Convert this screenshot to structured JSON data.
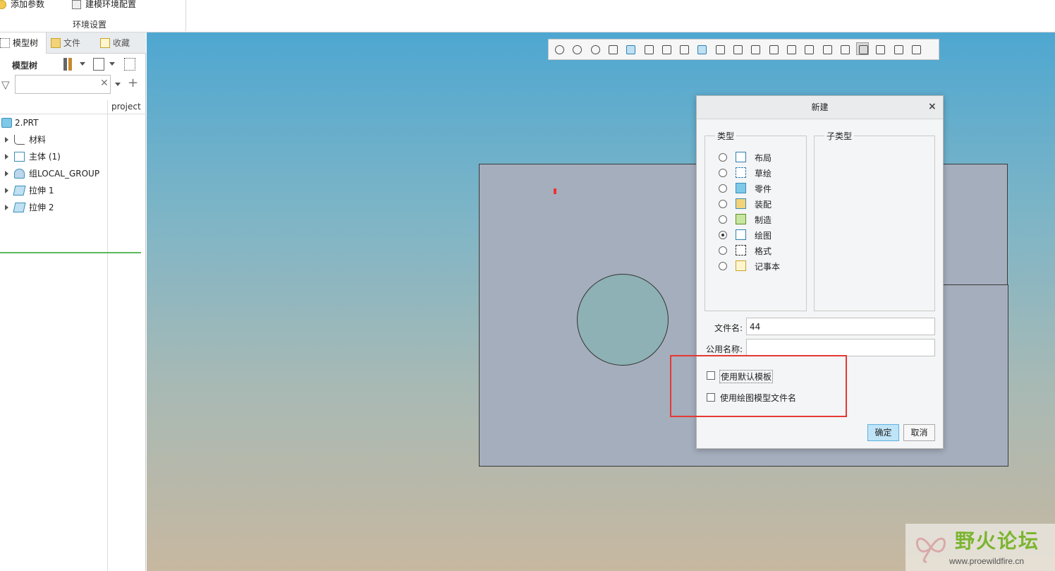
{
  "ribbon": {
    "add_params": "添加参数",
    "model_env_config": "建模环境配置",
    "group_label": "环境设置"
  },
  "left_panel": {
    "tabs": [
      {
        "label": "模型树"
      },
      {
        "label": "文件"
      },
      {
        "label": "收藏"
      }
    ],
    "tree_title": "模型树",
    "search": {
      "value": "",
      "placeholder": ""
    },
    "columns": {
      "project": "project"
    },
    "tree": [
      {
        "label": "2.PRT",
        "icon": "part-icon"
      },
      {
        "label": "材料",
        "icon": "material-icon"
      },
      {
        "label": "主体 (1)",
        "icon": "body-icon"
      },
      {
        "label": "组LOCAL_GROUP",
        "icon": "group-icon"
      },
      {
        "label": "拉伸 1",
        "icon": "extrude-icon"
      },
      {
        "label": "拉伸 2",
        "icon": "extrude-icon"
      }
    ]
  },
  "view_toolbar": {
    "icons": [
      "refit-icon",
      "zoom-in-icon",
      "zoom-out-icon",
      "repaint-icon",
      "display-style-icon",
      "saved-views-icon",
      "view-manager-icon",
      "perspective-icon",
      "section-icon",
      "annotation-icon",
      "spin-center-icon",
      "csys-display-icon",
      "plane-display-icon",
      "axis-display-icon",
      "point-display-icon",
      "csys-icon",
      "layer-icon",
      "selection-filter-icon",
      "simulation-icon",
      "pause-icon",
      "appearance-icon"
    ]
  },
  "dialog": {
    "title": "新建",
    "close_glyph": "×",
    "type_group": "类型",
    "subtype_group": "子类型",
    "types": [
      {
        "label": "布局",
        "icon": "layout-icon",
        "selected": false
      },
      {
        "label": "草绘",
        "icon": "sketch-icon",
        "selected": false
      },
      {
        "label": "零件",
        "icon": "part-type-icon",
        "selected": false
      },
      {
        "label": "装配",
        "icon": "assembly-icon",
        "selected": false
      },
      {
        "label": "制造",
        "icon": "manufacturing-icon",
        "selected": false
      },
      {
        "label": "绘图",
        "icon": "drawing-icon",
        "selected": true
      },
      {
        "label": "格式",
        "icon": "format-icon",
        "selected": false
      },
      {
        "label": "记事本",
        "icon": "notebook-icon",
        "selected": false
      }
    ],
    "file_name_label": "文件名:",
    "file_name_value": "44",
    "common_name_label": "公用名称:",
    "common_name_value": "",
    "use_default_template": "使用默认模板",
    "use_drawing_model_name": "使用绘图模型文件名",
    "ok": "确定",
    "cancel": "取消"
  },
  "watermark": {
    "name": "野火论坛",
    "url": "www.proewildfire.cn"
  },
  "colors": {
    "accent": "#5fb1df",
    "highlight": "#e53935",
    "viewport_top": "#4ea7d1",
    "viewport_bottom": "#c7b8a0",
    "part": "#a5aebd"
  }
}
